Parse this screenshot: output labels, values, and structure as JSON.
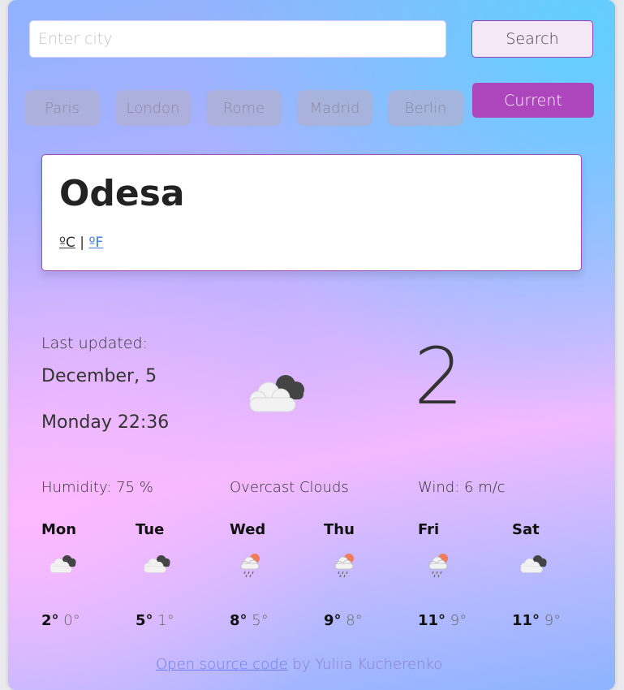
{
  "search": {
    "placeholder": "Enter city",
    "value": "",
    "button_label": "Search"
  },
  "cities": [
    "Paris",
    "London",
    "Rome",
    "Madrid",
    "Berlin"
  ],
  "current_button_label": "Current",
  "location": {
    "city": "Odesa",
    "unit_c": "ºC",
    "separator": "|",
    "unit_f": "ºF"
  },
  "current": {
    "last_updated_label": "Last updated:",
    "date": "December, 5",
    "day_time": "Monday 22:36",
    "temperature": "2",
    "weather_icon": "cloudy-icon",
    "humidity": "Humidity: 75 %",
    "description": "Overcast Clouds",
    "wind": "Wind: 6 m/c"
  },
  "forecast": [
    {
      "day": "Mon",
      "max": "2°",
      "min": "0°",
      "icon": "cloudy-icon"
    },
    {
      "day": "Tue",
      "max": "5°",
      "min": "1°",
      "icon": "cloudy-icon"
    },
    {
      "day": "Wed",
      "max": "8°",
      "min": "5°",
      "icon": "rain-sun-icon"
    },
    {
      "day": "Thu",
      "max": "9°",
      "min": "8°",
      "icon": "rain-sun-icon"
    },
    {
      "day": "Fri",
      "max": "11°",
      "min": "9°",
      "icon": "rain-sun-icon"
    },
    {
      "day": "Sat",
      "max": "11°",
      "min": "9°",
      "icon": "cloudy-icon"
    }
  ],
  "footer": {
    "link_text": "Open source code",
    "suffix": " by Yuliia Kucherenko"
  },
  "colors": {
    "accent": "#ad45bc",
    "border": "#a44bb8",
    "link": "#3b7bd6"
  }
}
